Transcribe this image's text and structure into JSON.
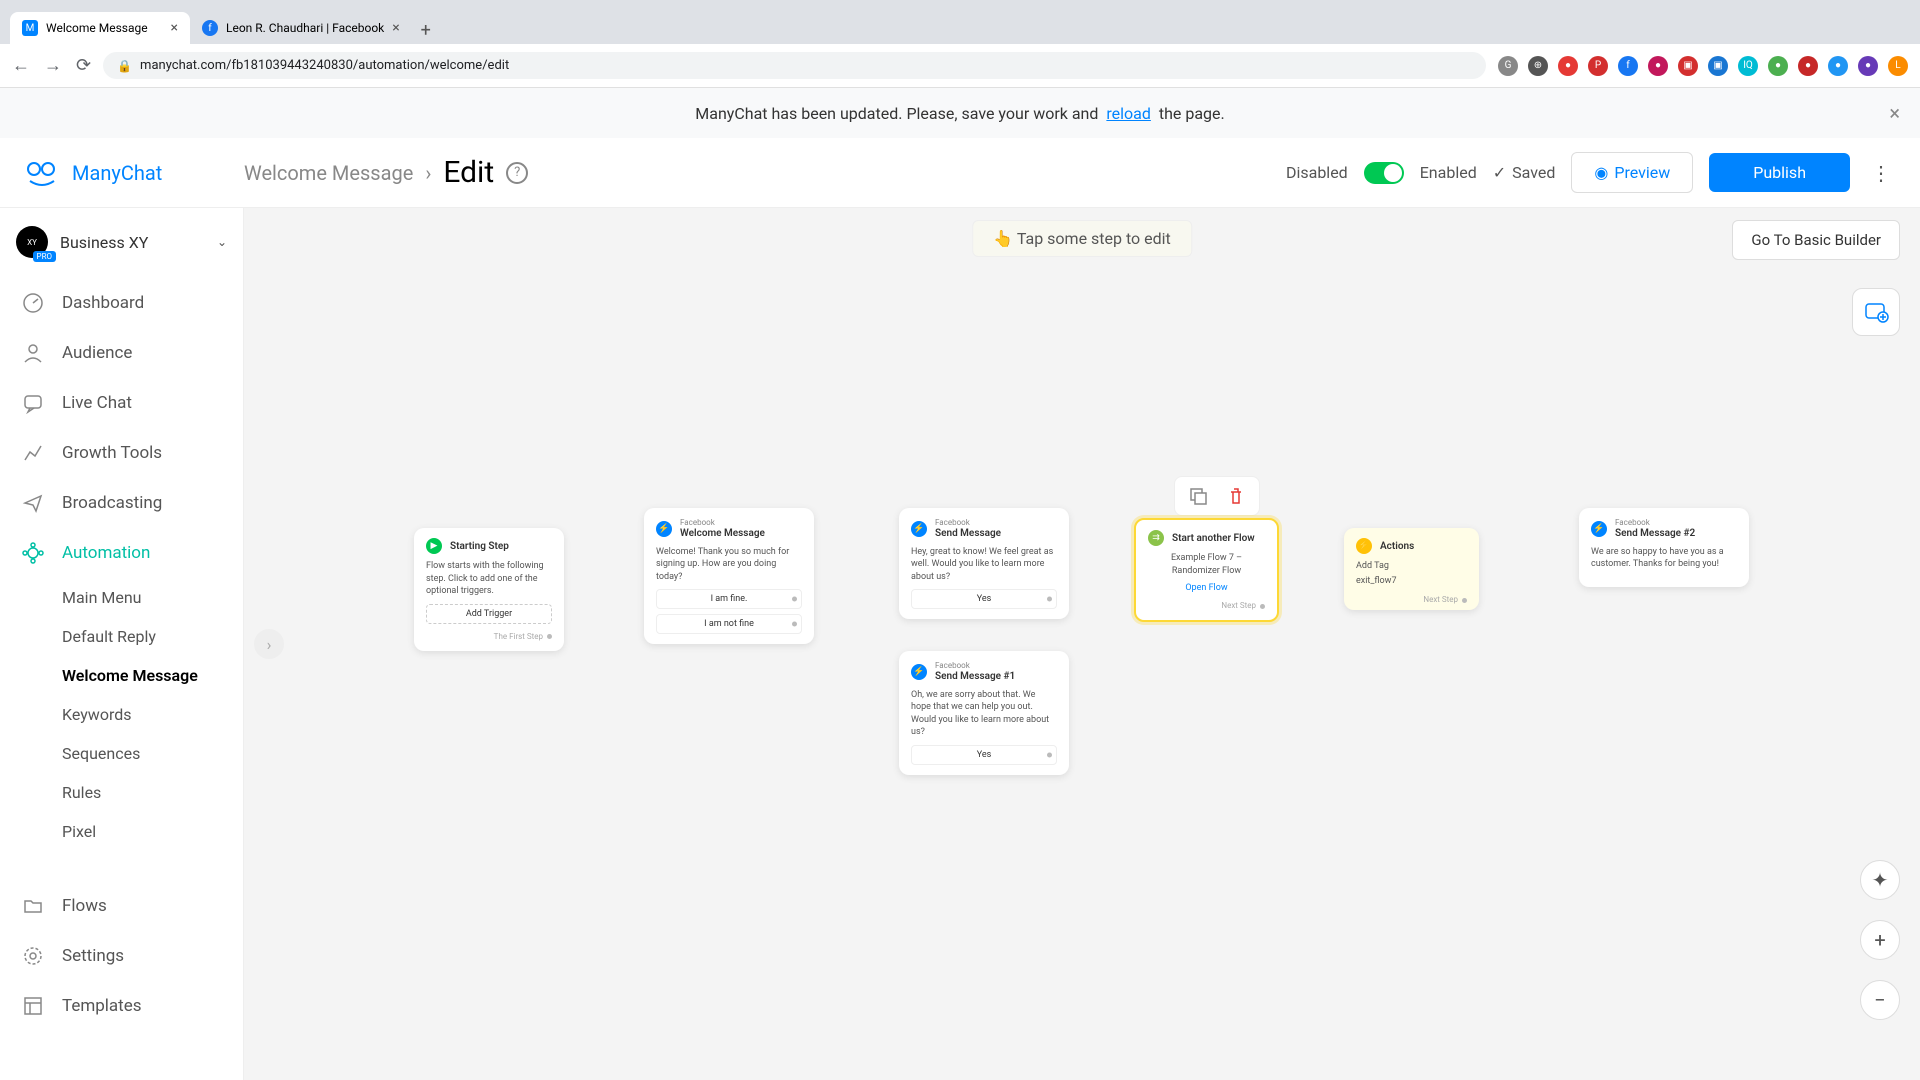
{
  "browser": {
    "tabs": [
      {
        "title": "Welcome Message",
        "favicon": "MC"
      },
      {
        "title": "Leon R. Chaudhari | Facebook",
        "favicon": "f"
      }
    ],
    "url": "manychat.com/fb181039443240830/automation/welcome/edit"
  },
  "banner": {
    "text_before": "ManyChat has been updated. Please, save your work and ",
    "link": "reload",
    "text_after": " the page."
  },
  "header": {
    "brand": "ManyChat",
    "breadcrumb": "Welcome Message",
    "edit_title": "Edit",
    "disabled": "Disabled",
    "enabled": "Enabled",
    "saved": "Saved",
    "preview": "Preview",
    "publish": "Publish"
  },
  "sidebar": {
    "org": "Business XY",
    "pro_badge": "PRO",
    "items": [
      {
        "label": "Dashboard"
      },
      {
        "label": "Audience"
      },
      {
        "label": "Live Chat"
      },
      {
        "label": "Growth Tools"
      },
      {
        "label": "Broadcasting"
      },
      {
        "label": "Automation"
      },
      {
        "label": "Flows"
      },
      {
        "label": "Settings"
      },
      {
        "label": "Templates"
      }
    ],
    "sub_items": [
      {
        "label": "Main Menu"
      },
      {
        "label": "Default Reply"
      },
      {
        "label": "Welcome Message"
      },
      {
        "label": "Keywords"
      },
      {
        "label": "Sequences"
      },
      {
        "label": "Rules"
      },
      {
        "label": "Pixel"
      }
    ]
  },
  "canvas": {
    "tap_hint": "👆 Tap some step to edit",
    "basic_builder": "Go To Basic Builder"
  },
  "nodes": {
    "start": {
      "title": "Starting Step",
      "body": "Flow starts with the following step. Click to add one of the optional triggers.",
      "action": "Add Trigger",
      "footer": "The First Step"
    },
    "welcome": {
      "sub": "Facebook",
      "title": "Welcome Message",
      "body": "Welcome! Thank you so much for signing up. How are you doing today?",
      "btn1": "I am fine.",
      "btn2": "I am not fine"
    },
    "send": {
      "sub": "Facebook",
      "title": "Send Message",
      "body": "Hey, great to know! We feel great as well. Would you like to learn more about us?",
      "btn1": "Yes"
    },
    "send1": {
      "sub": "Facebook",
      "title": "Send Message #1",
      "body": "Oh, we are sorry about that. We hope that we can help you out. Would you like to learn more about us?",
      "btn1": "Yes"
    },
    "flow": {
      "title": "Start another Flow",
      "body": "Example Flow 7 – Randomizer Flow",
      "link": "Open Flow",
      "footer": "Next Step"
    },
    "actions": {
      "title": "Actions",
      "line1": "Add Tag",
      "line2": "exit_flow7",
      "footer": "Next Step"
    },
    "send2": {
      "sub": "Facebook",
      "title": "Send Message #2",
      "body": "We are so happy to have you as a customer. Thanks for being you!"
    }
  }
}
